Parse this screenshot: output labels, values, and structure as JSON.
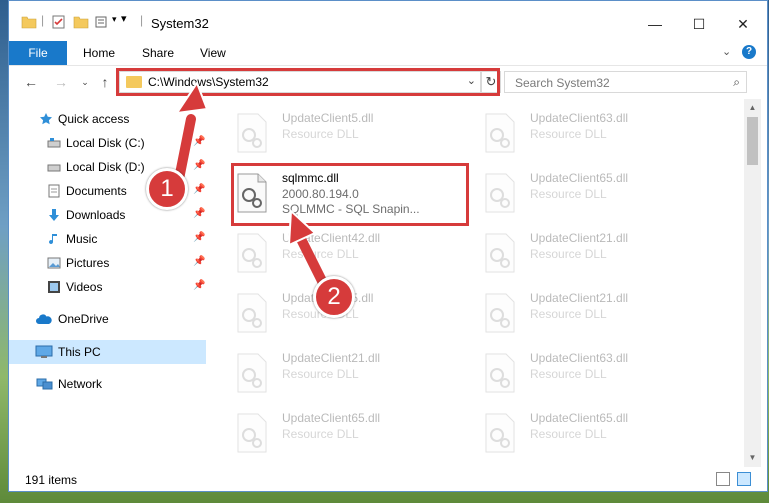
{
  "window": {
    "title": "System32"
  },
  "controls": {
    "minimize": "—",
    "maximize": "☐",
    "close": "✕"
  },
  "ribbon": {
    "tabs": [
      "File",
      "Home",
      "Share",
      "View"
    ],
    "expand_icon": "chevron-down-icon",
    "help": "?"
  },
  "address": {
    "path": "C:\\Windows\\System32",
    "dropdown": "⌄",
    "refresh": "↻"
  },
  "search": {
    "placeholder": "Search System32",
    "icon": "⌕"
  },
  "nav": {
    "items": [
      {
        "label": "Quick access",
        "icon": "star-icon"
      },
      {
        "label": "Local Disk (C:)",
        "icon": "drive-icon",
        "pinned": true
      },
      {
        "label": "Local Disk (D:)",
        "icon": "drive-icon",
        "pinned": true
      },
      {
        "label": "Documents",
        "icon": "documents-icon",
        "pinned": true
      },
      {
        "label": "Downloads",
        "icon": "downloads-icon",
        "pinned": true
      },
      {
        "label": "Music",
        "icon": "music-icon",
        "pinned": true
      },
      {
        "label": "Pictures",
        "icon": "pictures-icon",
        "pinned": true
      },
      {
        "label": "Videos",
        "icon": "videos-icon",
        "pinned": true
      },
      {
        "label": "OneDrive",
        "icon": "cloud-icon"
      },
      {
        "label": "This PC",
        "icon": "computer-icon",
        "selected": true
      },
      {
        "label": "Network",
        "icon": "network-icon"
      }
    ]
  },
  "files": {
    "left": [
      {
        "name": "UpdateClient5.dll",
        "type": "Resource DLL"
      },
      {
        "name": "sqlmmc.dll",
        "version": "2000.80.194.0",
        "type": "SQLMMC - SQL Snapin..."
      },
      {
        "name": "UpdateClient42.dll",
        "type": "Resource DLL"
      },
      {
        "name": "UpdateClient5.dll",
        "type": "Resource DLL"
      },
      {
        "name": "UpdateClient21.dll",
        "type": "Resource DLL"
      },
      {
        "name": "UpdateClient65.dll",
        "type": "Resource DLL"
      }
    ],
    "right": [
      {
        "name": "UpdateClient63.dll",
        "type": "Resource DLL"
      },
      {
        "name": "UpdateClient65.dll",
        "type": "Resource DLL"
      },
      {
        "name": "UpdateClient21.dll",
        "type": "Resource DLL"
      },
      {
        "name": "UpdateClient21.dll",
        "type": "Resource DLL"
      },
      {
        "name": "UpdateClient63.dll",
        "type": "Resource DLL"
      },
      {
        "name": "UpdateClient65.dll",
        "type": "Resource DLL"
      }
    ]
  },
  "status": {
    "count": "191 items"
  },
  "annotations": {
    "step1": "1",
    "step2": "2"
  },
  "colors": {
    "accent": "#1979ca",
    "highlight": "#d63b3b",
    "selected": "#cce8ff"
  }
}
